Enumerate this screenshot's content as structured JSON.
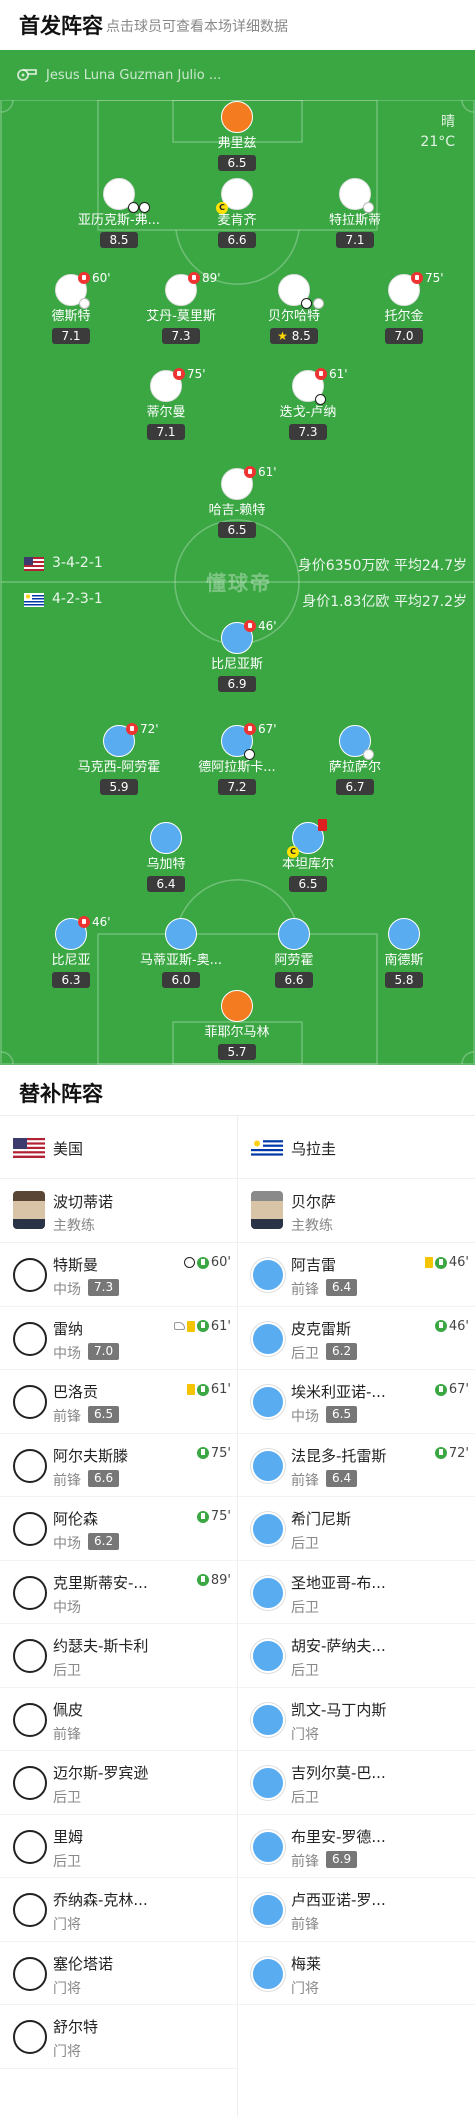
{
  "header": {
    "title": "首发阵容",
    "hint": "点击球员可查看本场详细数据"
  },
  "pitch": {
    "referee": "Jesus Luna Guzman Julio ...",
    "weather": "晴",
    "temperature": "21°C",
    "logo_text": "懂球帝",
    "colors": {
      "grass": "#3aa743",
      "home_dot": "#ffffff",
      "away_dot": "#5aacf0",
      "keeper_dot": "#f47b20"
    },
    "home": {
      "formation": "3-4-2-1",
      "stats": "身价6350万欧  平均24.7岁"
    },
    "away": {
      "formation": "4-2-3-1",
      "stats": "身价1.83亿欧  平均27.2岁"
    },
    "players": [
      {
        "name": "弗里兹",
        "rating": "6.5",
        "team": "home",
        "keeper": true
      },
      {
        "name": "亚历克斯-弗...",
        "rating": "8.5",
        "team": "home",
        "events": [
          "goal",
          "goal"
        ]
      },
      {
        "name": "麦肯齐",
        "rating": "6.6",
        "team": "home",
        "captain": true
      },
      {
        "name": "特拉斯蒂",
        "rating": "7.1",
        "team": "home",
        "events": [
          "assist"
        ]
      },
      {
        "name": "德斯特",
        "rating": "7.1",
        "team": "home",
        "sub_off": "60'"
      },
      {
        "name": "艾丹-莫里斯",
        "rating": "7.3",
        "team": "home",
        "sub_off": "89'"
      },
      {
        "name": "贝尔哈特",
        "rating": "8.5",
        "team": "home",
        "star": true,
        "events": [
          "goal",
          "assist"
        ]
      },
      {
        "name": "托尔金",
        "rating": "7.0",
        "team": "home",
        "sub_off": "75'"
      },
      {
        "name": "蒂尔曼",
        "rating": "7.1",
        "team": "home",
        "sub_off": "75'"
      },
      {
        "name": "迭戈-卢纳",
        "rating": "7.3",
        "team": "home",
        "sub_off": "61'",
        "events": [
          "goal"
        ]
      },
      {
        "name": "哈吉-赖特",
        "rating": "6.5",
        "team": "home",
        "sub_off": "61'"
      },
      {
        "name": "比尼亚斯",
        "rating": "6.9",
        "team": "away",
        "sub_off": "46'"
      },
      {
        "name": "马克西-阿劳霍",
        "rating": "5.9",
        "team": "away",
        "sub_off": "72'"
      },
      {
        "name": "德阿拉斯卡...",
        "rating": "7.2",
        "team": "away",
        "sub_off": "67'",
        "events": [
          "goal"
        ]
      },
      {
        "name": "萨拉萨尔",
        "rating": "6.7",
        "team": "away",
        "events": [
          "assist"
        ]
      },
      {
        "name": "乌加特",
        "rating": "6.4",
        "team": "away"
      },
      {
        "name": "本坦库尔",
        "rating": "6.5",
        "team": "away",
        "captain": true,
        "red_card": true
      },
      {
        "name": "比尼亚",
        "rating": "6.3",
        "team": "away",
        "sub_off": "46'"
      },
      {
        "name": "马蒂亚斯-奥...",
        "rating": "6.0",
        "team": "away"
      },
      {
        "name": "阿劳霍",
        "rating": "6.6",
        "team": "away"
      },
      {
        "name": "南德斯",
        "rating": "5.8",
        "team": "away"
      },
      {
        "name": "菲耶尔马林",
        "rating": "5.7",
        "team": "away",
        "keeper": true
      }
    ]
  },
  "subs": {
    "title": "替补阵容",
    "home": {
      "team_name": "美国",
      "coach": {
        "name": "波切蒂诺",
        "role": "主教练"
      },
      "players": [
        {
          "name": "特斯曼",
          "pos": "中场",
          "rating": "7.3",
          "minute": "60'",
          "icons": [
            "ball",
            "in"
          ]
        },
        {
          "name": "雷纳",
          "pos": "中场",
          "rating": "7.0",
          "minute": "61'",
          "icons": [
            "boot",
            "yc",
            "in"
          ]
        },
        {
          "name": "巴洛贡",
          "pos": "前锋",
          "rating": "6.5",
          "minute": "61'",
          "icons": [
            "yc",
            "in"
          ]
        },
        {
          "name": "阿尔夫斯滕",
          "pos": "前锋",
          "rating": "6.6",
          "minute": "75'",
          "icons": [
            "in"
          ]
        },
        {
          "name": "阿伦森",
          "pos": "中场",
          "rating": "6.2",
          "minute": "75'",
          "icons": [
            "in"
          ]
        },
        {
          "name": "克里斯蒂安-...",
          "pos": "中场",
          "rating": "",
          "minute": "89'",
          "icons": [
            "in"
          ]
        },
        {
          "name": "约瑟夫-斯卡利",
          "pos": "后卫",
          "rating": "",
          "minute": "",
          "icons": []
        },
        {
          "name": "佩皮",
          "pos": "前锋",
          "rating": "",
          "minute": "",
          "icons": []
        },
        {
          "name": "迈尔斯-罗宾逊",
          "pos": "后卫",
          "rating": "",
          "minute": "",
          "icons": []
        },
        {
          "name": "里姆",
          "pos": "后卫",
          "rating": "",
          "minute": "",
          "icons": []
        },
        {
          "name": "乔纳森-克林...",
          "pos": "门将",
          "rating": "",
          "minute": "",
          "icons": []
        },
        {
          "name": "塞伦塔诺",
          "pos": "门将",
          "rating": "",
          "minute": "",
          "icons": []
        },
        {
          "name": "舒尔特",
          "pos": "门将",
          "rating": "",
          "minute": "",
          "icons": []
        }
      ]
    },
    "away": {
      "team_name": "乌拉圭",
      "coach": {
        "name": "贝尔萨",
        "role": "主教练"
      },
      "players": [
        {
          "name": "阿吉雷",
          "pos": "前锋",
          "rating": "6.4",
          "minute": "46'",
          "icons": [
            "yc",
            "in"
          ]
        },
        {
          "name": "皮克雷斯",
          "pos": "后卫",
          "rating": "6.2",
          "minute": "46'",
          "icons": [
            "in"
          ]
        },
        {
          "name": "埃米利亚诺-...",
          "pos": "中场",
          "rating": "6.5",
          "minute": "67'",
          "icons": [
            "in"
          ]
        },
        {
          "name": "法昆多-托雷斯",
          "pos": "前锋",
          "rating": "6.4",
          "minute": "72'",
          "icons": [
            "in"
          ]
        },
        {
          "name": "希门尼斯",
          "pos": "后卫",
          "rating": "",
          "minute": "",
          "icons": []
        },
        {
          "name": "圣地亚哥-布...",
          "pos": "后卫",
          "rating": "",
          "minute": "",
          "icons": []
        },
        {
          "name": "胡安-萨纳夫...",
          "pos": "后卫",
          "rating": "",
          "minute": "",
          "icons": []
        },
        {
          "name": "凯文-马丁内斯",
          "pos": "门将",
          "rating": "",
          "minute": "",
          "icons": []
        },
        {
          "name": "吉列尔莫-巴...",
          "pos": "后卫",
          "rating": "",
          "minute": "",
          "icons": []
        },
        {
          "name": "布里安-罗德...",
          "pos": "前锋",
          "rating": "6.9",
          "minute": "",
          "icons": []
        },
        {
          "name": "卢西亚诺-罗...",
          "pos": "前锋",
          "rating": "",
          "minute": "",
          "icons": []
        },
        {
          "name": "梅莱",
          "pos": "门将",
          "rating": "",
          "minute": "",
          "icons": []
        }
      ]
    }
  }
}
